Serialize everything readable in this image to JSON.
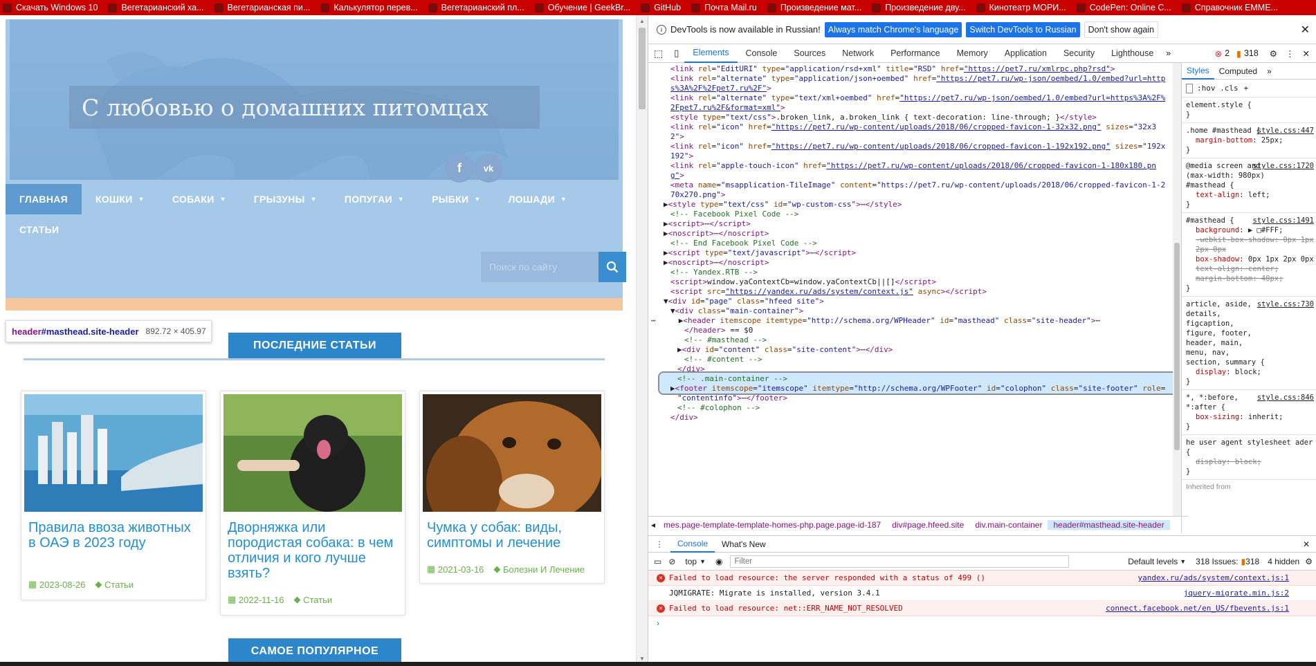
{
  "bookmarks": [
    {
      "label": "Скачать Windows 10",
      "icon": "windows-icon"
    },
    {
      "label": "Вегетарианский ха...",
      "icon": "strawberry-icon"
    },
    {
      "label": "Вегетарианская пи...",
      "icon": "globe-icon"
    },
    {
      "label": "Калькулятор перев...",
      "icon": "leaf-icon"
    },
    {
      "label": "Вегетарианский пл...",
      "icon": "star-icon"
    },
    {
      "label": "Обучение | GeekBr...",
      "icon": "geekbrains-icon"
    },
    {
      "label": "GitHub",
      "icon": "github-icon"
    },
    {
      "label": "Почта Mail.ru",
      "icon": "mail-icon"
    },
    {
      "label": "Произведение мат...",
      "icon": "fx-icon"
    },
    {
      "label": "Произведение дву...",
      "icon": "fx-icon"
    },
    {
      "label": "Кинотеатр МОРИ...",
      "icon": "cinema-icon"
    },
    {
      "label": "CodePen: Online C...",
      "icon": "codepen-icon"
    },
    {
      "label": "Справочник EMME...",
      "icon": "emmet-icon"
    }
  ],
  "site": {
    "title": "С любовью о домашних питомцах",
    "social": [
      "f",
      "vk"
    ],
    "nav": [
      {
        "label": "ГЛАВНАЯ",
        "dropdown": false
      },
      {
        "label": "КОШКИ",
        "dropdown": true
      },
      {
        "label": "СОБАКИ",
        "dropdown": true
      },
      {
        "label": "ГРЫЗУНЫ",
        "dropdown": true
      },
      {
        "label": "ПОПУГАИ",
        "dropdown": true
      },
      {
        "label": "РЫБКИ",
        "dropdown": true
      },
      {
        "label": "ЛОШАДИ",
        "dropdown": true
      },
      {
        "label": "СТАТЬИ",
        "dropdown": false
      }
    ],
    "search_placeholder": "Поиск по сайту",
    "tooltip": {
      "tag": "header",
      "id": "#masthead.site-header",
      "dims": "892.72 × 405.97"
    },
    "section_latest": "ПОСЛЕДНИЕ СТАТЬИ",
    "section_popular": "САМОЕ ПОПУЛЯРНОЕ",
    "cards": [
      {
        "title": "Правила ввоза животных в ОАЭ в 2023 году",
        "date": "2023-08-26",
        "category": "Статьи"
      },
      {
        "title": "Дворняжка или породистая собака: в чем отличия и кого лучше взять?",
        "date": "2022-11-16",
        "category": "Статьи"
      },
      {
        "title": "Чумка у собак: виды, симптомы и лечение",
        "date": "2021-03-16",
        "category": "Болезни И Лечение"
      }
    ]
  },
  "devtools": {
    "info_text": "DevTools is now available in Russian!",
    "info_btn1": "Always match Chrome's language",
    "info_btn2": "Switch DevTools to Russian",
    "info_btn3": "Don't show again",
    "tabs": [
      "Elements",
      "Console",
      "Sources",
      "Network",
      "Performance",
      "Memory",
      "Application",
      "Security",
      "Lighthouse"
    ],
    "errors_count": "2",
    "warnings_count": "318",
    "breadcrumbs": [
      "mes.page-template-template-homes-php.page.page-id-187",
      "div#page.hfeed.site",
      "div.main-container",
      "header#masthead.site-header"
    ],
    "styles_tabs": [
      "Styles",
      "Computed"
    ],
    "styles_filter": ":hov  .cls",
    "styles_rules": [
      {
        "selector": "element.style {",
        "source": "",
        "props": []
      },
      {
        "selector": ".home #masthead {",
        "source": "style.css:447",
        "props": [
          {
            "n": "margin-bottom",
            "v": "25px;",
            "s": false
          }
        ]
      },
      {
        "selector": "@media screen and (max-width: 980px) #masthead {",
        "source": "style.css:1720",
        "props": [
          {
            "n": "text-align",
            "v": "left;",
            "s": false
          }
        ]
      },
      {
        "selector": "#masthead {",
        "source": "style.css:1491",
        "props": [
          {
            "n": "background",
            "v": "▶ □#FFF;",
            "s": false
          },
          {
            "n": "-webkit-box-shadow",
            "v": "0px 1px 2px 0px",
            "s": true
          },
          {
            "n": "box-shadow",
            "v": "0px 1px 2px 0px",
            "s": false
          },
          {
            "n": "text-align",
            "v": "center;",
            "s": true
          },
          {
            "n": "margin-bottom",
            "v": "40px;",
            "s": true
          }
        ]
      },
      {
        "selector": "article, aside, details, figcaption, figure, footer, header, main, menu, nav, section, summary {",
        "source": "style.css:730",
        "props": [
          {
            "n": "display",
            "v": "block;",
            "s": false
          }
        ]
      },
      {
        "selector": "*, *:before, *:after {",
        "source": "style.css:846",
        "props": [
          {
            "n": "box-sizing",
            "v": "inherit;",
            "s": false
          }
        ]
      },
      {
        "selector": "he user agent stylesheet ader {",
        "source": "",
        "props": [
          {
            "n": "display",
            "v": "block;",
            "s": true
          }
        ]
      }
    ],
    "styles_footer": "Inherited from",
    "console": {
      "tabs": [
        "Console",
        "What's New"
      ],
      "context": "top",
      "filter_placeholder": "Filter",
      "levels": "Default levels",
      "issues": "318 Issues:",
      "issues_count": "318",
      "hidden": "4 hidden",
      "messages": [
        {
          "type": "error",
          "text": "Failed to load resource: the server responded with a status of 499 ()",
          "link": "yandex.ru/ads/system/context.js:1"
        },
        {
          "type": "log",
          "text": "JQMIGRATE: Migrate is installed, version 3.4.1",
          "link": "jquery-migrate.min.js:2"
        },
        {
          "type": "error",
          "text": "Failed to load resource: net::ERR_NAME_NOT_RESOLVED",
          "link": "connect.facebook.net/en_US/fbevents.js:1"
        }
      ]
    }
  }
}
